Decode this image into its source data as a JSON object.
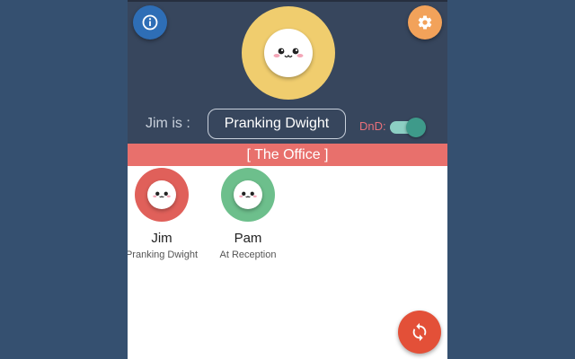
{
  "colors": {
    "background": "#355070",
    "header": "#37465d",
    "info_button": "#2e6eb6",
    "settings_button": "#f2a25a",
    "user_avatar_ring": "#f0cd6e",
    "group_bar": "#e8706c",
    "dnd_label": "#e8707a",
    "toggle_on": "#3e9a8a",
    "refresh_button": "#e35038"
  },
  "header": {
    "info_icon": "info-icon",
    "settings_icon": "gear-icon",
    "status_label": "Jim is :",
    "status_value": "Pranking Dwight",
    "dnd_label": "DnD:",
    "dnd_enabled": true
  },
  "group": {
    "name": "[ The Office ]"
  },
  "members": [
    {
      "name": "Jim",
      "status": "Pranking Dwight",
      "ring_color": "#e0605a"
    },
    {
      "name": "Pam",
      "status": "At Reception",
      "ring_color": "#6dbf8c"
    }
  ],
  "refresh_icon": "refresh-icon"
}
